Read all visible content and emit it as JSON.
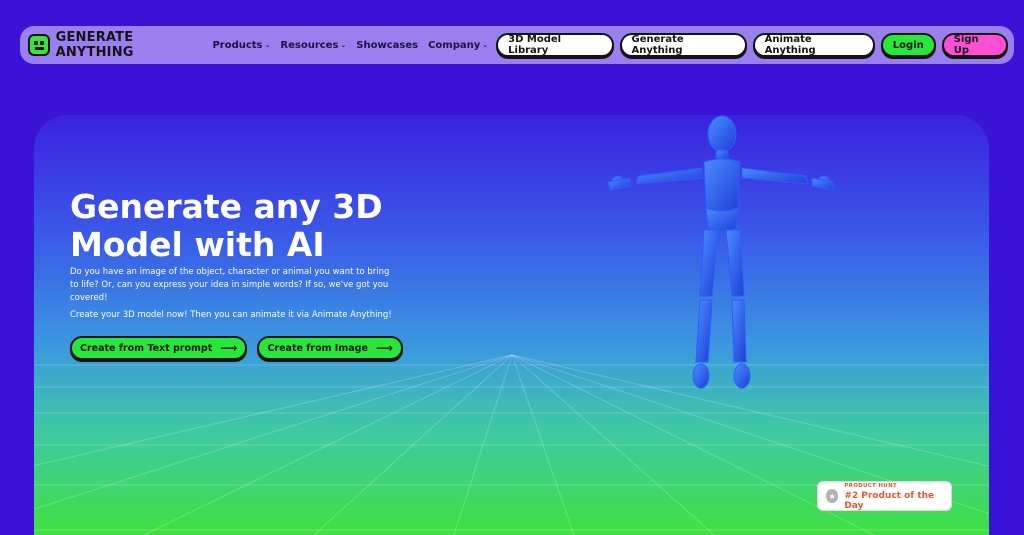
{
  "brand": {
    "name": "GENERATE ANYTHING",
    "icon": "logo-face-icon"
  },
  "nav": {
    "links": [
      {
        "label": "Products",
        "has_dropdown": true
      },
      {
        "label": "Resources",
        "has_dropdown": true
      },
      {
        "label": "Showcases",
        "has_dropdown": false
      },
      {
        "label": "Company",
        "has_dropdown": true
      }
    ],
    "buttons": [
      {
        "label": "3D Model Library",
        "style": "white"
      },
      {
        "label": "Generate Anything",
        "style": "white"
      },
      {
        "label": "Animate Anything",
        "style": "white"
      },
      {
        "label": "Login",
        "style": "green"
      },
      {
        "label": "Sign Up",
        "style": "pink"
      }
    ]
  },
  "hero": {
    "title_line1": "Generate any 3D",
    "title_line2": "Model with AI",
    "description": "Do you have an image of the object, character or animal you want to bring to life? Or, can you express your idea in simple words? If so, we've got you covered!",
    "cta_text": "Create your 3D model now! Then you can animate it via Animate Anything!",
    "buttons": [
      {
        "label": "Create from Text prompt",
        "icon": "arrow-right-icon"
      },
      {
        "label": "Create from Image",
        "icon": "arrow-right-icon"
      }
    ]
  },
  "badge": {
    "label": "PRODUCT HUNT",
    "rank": "#2 Product of the Day",
    "icon": "medal-icon"
  },
  "colors": {
    "background": "#3a14d6",
    "nav": "#9a7ff0",
    "accent_green": "#27e83a",
    "accent_pink": "#ff4ed3",
    "badge_text": "#da5b36"
  }
}
